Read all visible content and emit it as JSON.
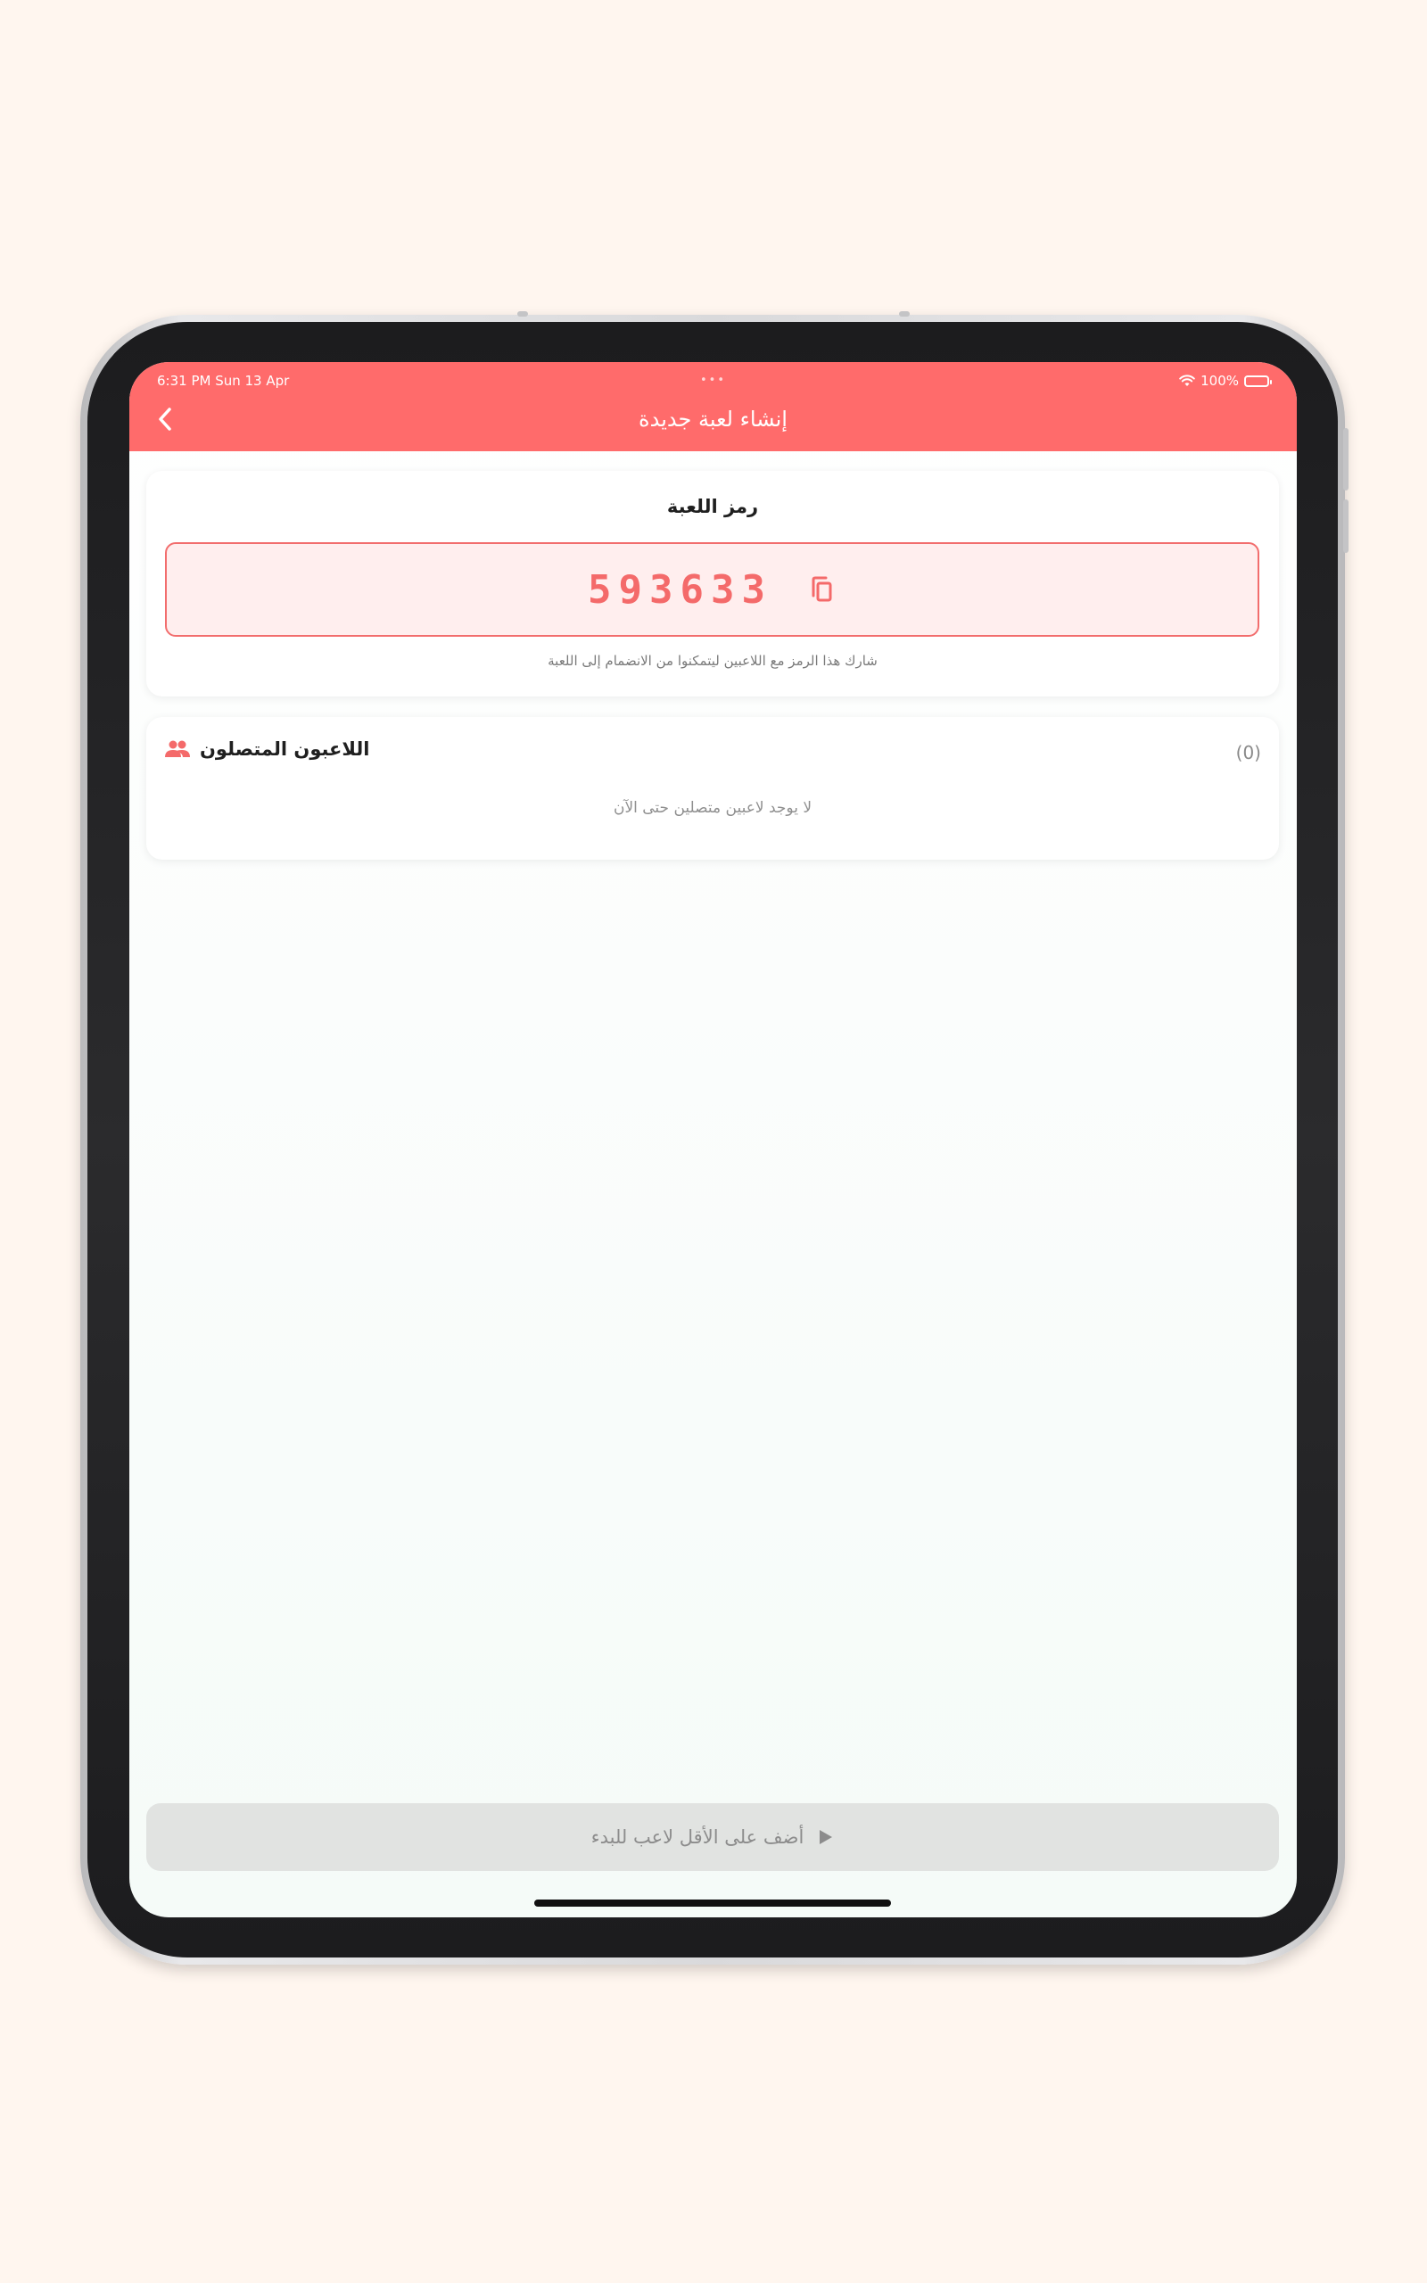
{
  "status_bar": {
    "time": "6:31 PM   Sun 13 Apr",
    "battery": "100%",
    "multitask_dots": "•••"
  },
  "nav": {
    "title": "إنشاء لعبة جديدة",
    "back_icon": "chevron-left-icon"
  },
  "game_code": {
    "label": "رمز اللعبة",
    "code": "593633",
    "copy_icon": "copy-icon",
    "hint": "شارك هذا الرمز مع اللاعبين ليتمكنوا من الانضمام إلى اللعبة"
  },
  "players": {
    "title": "اللاعبون المتصلون",
    "icon": "group-icon",
    "count": "(0)",
    "empty_text": "لا يوجد لاعبين متصلين حتى الآن"
  },
  "start_button": {
    "label": "أضف على الأقل لاعب للبدء",
    "icon": "play-icon",
    "enabled": false
  },
  "colors": {
    "accent": "#ff6b6b",
    "background": "#fff6ef",
    "disabled_button": "#e1e3e1"
  }
}
